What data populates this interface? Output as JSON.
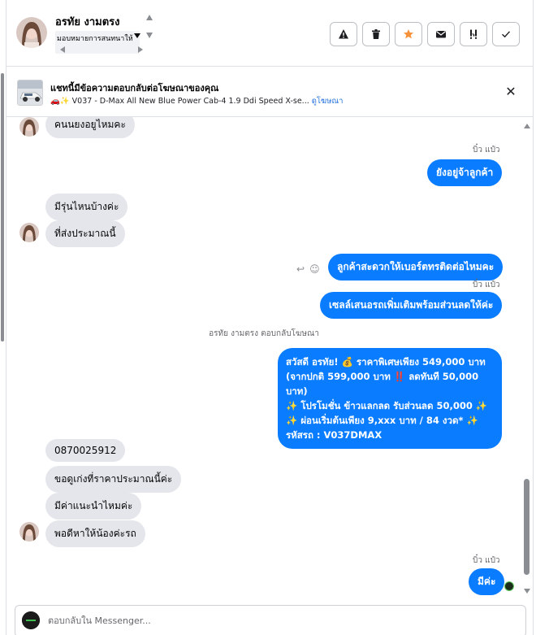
{
  "header": {
    "contact_name": "อรทัย งามตรง",
    "assign_label": "มอบหมายการสนทนาให้",
    "actions": [
      {
        "name": "report-button",
        "icon": "warning-icon",
        "glyph": "▲"
      },
      {
        "name": "delete-button",
        "icon": "trash-icon",
        "glyph": ""
      },
      {
        "name": "star-button",
        "icon": "star-icon",
        "glyph": "★"
      },
      {
        "name": "mark-unread-button",
        "icon": "envelope-icon",
        "glyph": "✉"
      },
      {
        "name": "follow-up-button",
        "icon": "follow-up-icon",
        "glyph": "!!"
      },
      {
        "name": "mark-done-button",
        "icon": "check-icon",
        "glyph": "✓"
      }
    ],
    "star_color": "#f7923b"
  },
  "ad_banner": {
    "title": "แชทนี้มีข้อความตอบกลับต่อโฆษณาของคุณ",
    "subtitle": "🚗✨ V037 - D-Max All New Blue Power Cab-4 1.9 Ddi Speed X-se...",
    "link": "ดูโฆษณา",
    "close_icon": "close-icon"
  },
  "messages": {
    "m1": "คนนยงอยูไหมคะ",
    "sender1": "บิ๋ว แป๋ว",
    "m2": "ยังอยู่จ้าลูกค้า",
    "m3": "มีรุ่นไหนบ้างค่ะ",
    "m4": "ที่ส่งประมาณนี้",
    "m5": "ลูกค้าสะดวกให้เบอร์ตทรติดต่อไหมคะ",
    "sender2": "บิ๋ว แป๋ว",
    "m6": "เซลล์เสนอรถเพิ่มเติมพร้อมส่วนลดให้ค่ะ",
    "ad_reply_note": "อรทัย งามตรง ตอบกลับโฆษณา",
    "promo": "สวัสดี อรทัย! 💰 ราคาพิเศษเพียง 549,000 บาท\n(จากปกติ 599,000 บาท ‼️ ลดทันที 50,000 บาท)\n✨ โปรโมชั่น ข้าวแลกลด รับส่วนลด 50,000 ✨\n✨ ผ่อนเริ่มต้นเพียง 9,xxx บาท / 84 งวด* ✨\nรหัสรถ : V037DMAX",
    "m7": "0870025912",
    "m8": "ขอดูเก่งที่ราคาประมาณนี้ค่ะ",
    "m9": "มีค่าแนะนำไหมค่ะ",
    "m10": "พอดีหาให้น้องค่ะรถ",
    "sender3": "บิ๋ว แป๋ว",
    "m11": "มีค่ะ"
  },
  "composer": {
    "placeholder": "ตอบกลับใน Messenger..."
  },
  "colors": {
    "outgoing_bubble": "#0a7cff",
    "incoming_bubble": "#e4e6eb",
    "link": "#216fdb"
  }
}
